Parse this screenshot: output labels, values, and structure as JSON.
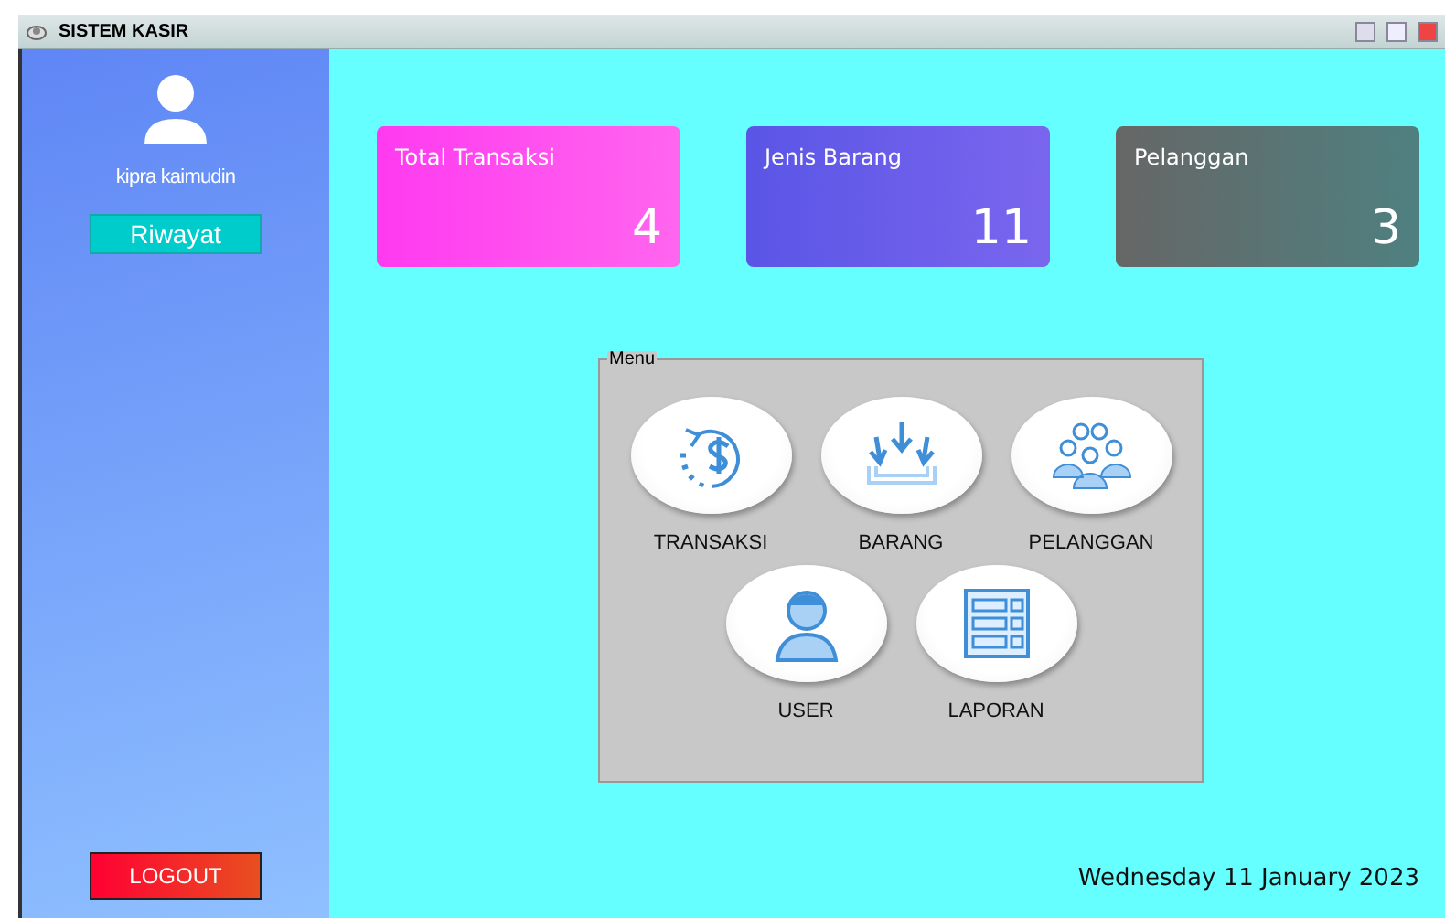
{
  "window": {
    "title": "SISTEM KASIR"
  },
  "sidebar": {
    "user_name": "kipra kaimudin",
    "history_button": "Riwayat",
    "logout_button": "LOGOUT"
  },
  "cards": [
    {
      "title": "Total Transaksi",
      "value": "4"
    },
    {
      "title": "Jenis Barang",
      "value": "11"
    },
    {
      "title": "Pelanggan",
      "value": "3"
    }
  ],
  "menu": {
    "legend": "Menu",
    "rows": [
      [
        {
          "label": "TRANSAKSI",
          "kind": "money"
        },
        {
          "label": "BARANG",
          "kind": "inbox"
        },
        {
          "label": "PELANGGAN",
          "kind": "group"
        }
      ],
      [
        {
          "label": "USER",
          "kind": "person"
        },
        {
          "label": "LAPORAN",
          "kind": "list"
        }
      ]
    ]
  },
  "date": "Wednesday 11 January 2023"
}
